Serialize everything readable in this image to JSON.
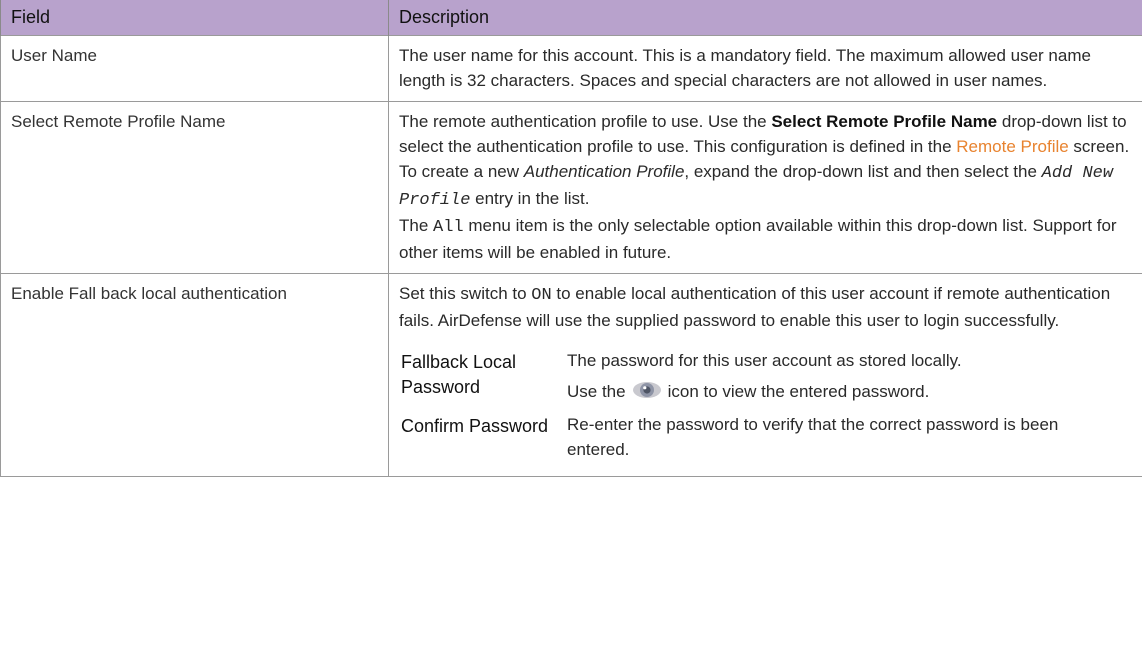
{
  "header": {
    "col_field": "Field",
    "col_description": "Description"
  },
  "rows": [
    {
      "field": "User Name",
      "desc": "The user name for this account. This is a mandatory field. The maximum allowed user name length is 32 characters. Spaces and special characters are not allowed in user names."
    },
    {
      "field": "Select Remote Profile Name",
      "p1_a": "The remote authentication profile to use. Use the ",
      "p1_bold": "Select Remote Profile Name",
      "p1_b": " drop-down list to select the authentication profile to use. This configuration is defined in the ",
      "p1_link": "Remote Profile",
      "p1_c": " screen. To create a new ",
      "p1_italic": "Authentication Profile",
      "p1_d": ", expand the drop-down list and then select the ",
      "p1_code": "Add New Profile",
      "p1_e": " entry in the list.",
      "p2_a": "The ",
      "p2_code": "All",
      "p2_b": " menu item is the only selectable option available within this drop-down list. Support for other items will be enabled in future."
    },
    {
      "field": "Enable Fall back local authentication",
      "p_a": "Set this switch to ",
      "p_code": "ON",
      "p_b": " to enable local authentication of this user account if remote authentication fails. AirDefense will use the supplied password to enable this user to login successfully.",
      "sub": [
        {
          "key": "Fallback Local Password",
          "val_a": "The password for this user account as stored locally.",
          "val_b": "Use the",
          "val_c": "icon to view the entered password.",
          "icon": "eye-icon"
        },
        {
          "key": "Confirm Password",
          "val_a": "Re-enter the password to verify that the correct password is been entered."
        }
      ]
    }
  ],
  "colors": {
    "header_bg": "#b8a2cc",
    "link": "#e8832f",
    "border": "#9a9a9a"
  }
}
